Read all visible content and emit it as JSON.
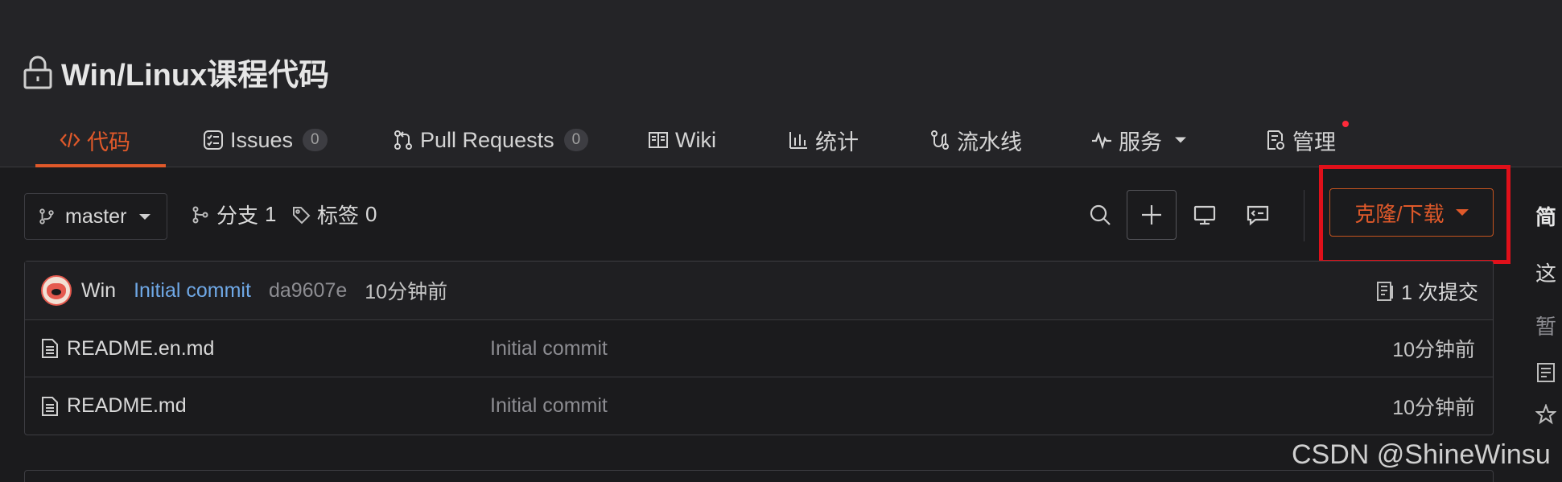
{
  "repo": {
    "title": "Win/Linux课程代码"
  },
  "tabs": [
    {
      "label": "代码",
      "icon": "code-icon"
    },
    {
      "label": "Issues",
      "icon": "issues-icon",
      "count": "0"
    },
    {
      "label": "Pull Requests",
      "icon": "pull-request-icon",
      "count": "0"
    },
    {
      "label": "Wiki",
      "icon": "book-icon"
    },
    {
      "label": "统计",
      "icon": "chart-icon"
    },
    {
      "label": "流水线",
      "icon": "pipeline-icon"
    },
    {
      "label": "服务",
      "icon": "pulse-icon"
    },
    {
      "label": "管理",
      "icon": "settings-doc-icon"
    }
  ],
  "toolbar": {
    "branch": "master",
    "branches_label": "分支",
    "branches_count": "1",
    "tags_label": "标签",
    "tags_count": "0",
    "clone_label": "克隆/下载"
  },
  "commit": {
    "author": "Win",
    "message": "Initial commit",
    "hash": "da9607e",
    "time": "10分钟前",
    "count_label": "1 次提交"
  },
  "files": [
    {
      "name": "README.en.md",
      "message": "Initial commit",
      "time": "10分钟前"
    },
    {
      "name": "README.md",
      "message": "Initial commit",
      "time": "10分钟前"
    }
  ],
  "sidebar": {
    "heading": "简",
    "desc": "这",
    "empty": "暂"
  },
  "watermark": "CSDN @ShineWinsu",
  "colors": {
    "accent": "#e0592a",
    "highlight": "#e0101a",
    "link": "#6fa8e6"
  }
}
